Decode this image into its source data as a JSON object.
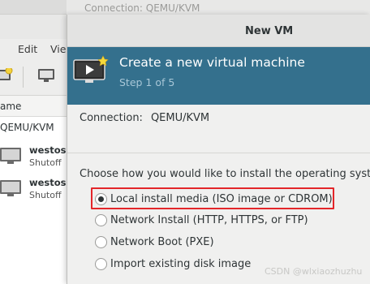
{
  "background_window": {
    "top_text": "Connection: QEMU/KVM",
    "menu": {
      "edit": "Edit",
      "view": "Vie"
    },
    "column_header": "ame",
    "connection": "QEMU/KVM",
    "vms": [
      {
        "name": "westosa",
        "state": "Shutoff"
      },
      {
        "name": "westosb",
        "state": "Shutoff"
      }
    ]
  },
  "dialog": {
    "title": "New VM",
    "banner": {
      "title": "Create a new virtual machine",
      "subtitle": "Step 1 of 5",
      "icon": "monitor-play-icon"
    },
    "connection_label": "Connection:",
    "connection_value": "QEMU/KVM",
    "question": "Choose how you would like to install the operating syste",
    "options": [
      {
        "label": "Local install media (ISO image or CDROM)",
        "checked": true
      },
      {
        "label": "Network Install (HTTP, HTTPS, or FTP)",
        "checked": false
      },
      {
        "label": "Network Boot (PXE)",
        "checked": false
      },
      {
        "label": "Import existing disk image",
        "checked": false
      }
    ]
  },
  "watermark": "CSDN @wlxiaozhuzhu",
  "colors": {
    "banner": "#34708d",
    "highlight": "#e3262a"
  }
}
